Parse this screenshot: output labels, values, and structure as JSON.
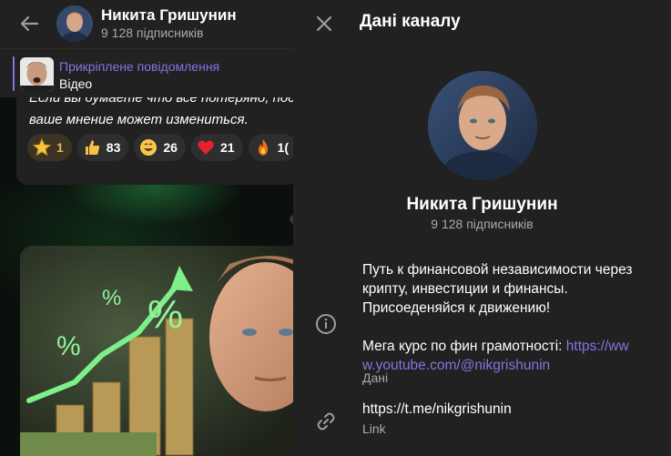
{
  "chat": {
    "channel_name": "Никита Гришунин",
    "subscribers": "9 128 підписників",
    "pinned": {
      "label": "Прикріплене повідомлення",
      "text": "Відео"
    },
    "message": {
      "line1": "Если вы думаете что все потеряно, пос",
      "line2": "ваше мнение может измениться."
    },
    "reactions": [
      {
        "emoji": "star-icon",
        "count": "1"
      },
      {
        "emoji": "thumbs-up-icon",
        "count": "83"
      },
      {
        "emoji": "grinning-face-icon",
        "count": "26"
      },
      {
        "emoji": "red-heart-icon",
        "count": "21"
      },
      {
        "emoji": "fire-icon",
        "count": "1("
      }
    ]
  },
  "panel": {
    "title": "Дані каналу",
    "name": "Никита Гришунин",
    "subscribers": "9 128 підписників",
    "description": {
      "line1": "Путь к финансовой независимости через",
      "line2": "крипту, инвестиции и финансы.",
      "line3": "Присоеденяйся к движению!",
      "course_text": "Мега курс по фин грамотності: ",
      "course_link_part1": "https://ww",
      "course_link_part2": "w.youtube.com/@nikgrishunin"
    },
    "description_caption": "Дані",
    "link_value": "https://t.me/nikgrishunin",
    "link_caption": "Link"
  },
  "colors": {
    "accent": "#8774e1",
    "panel_bg": "#212121",
    "secondary_text": "#aaaaaa"
  }
}
